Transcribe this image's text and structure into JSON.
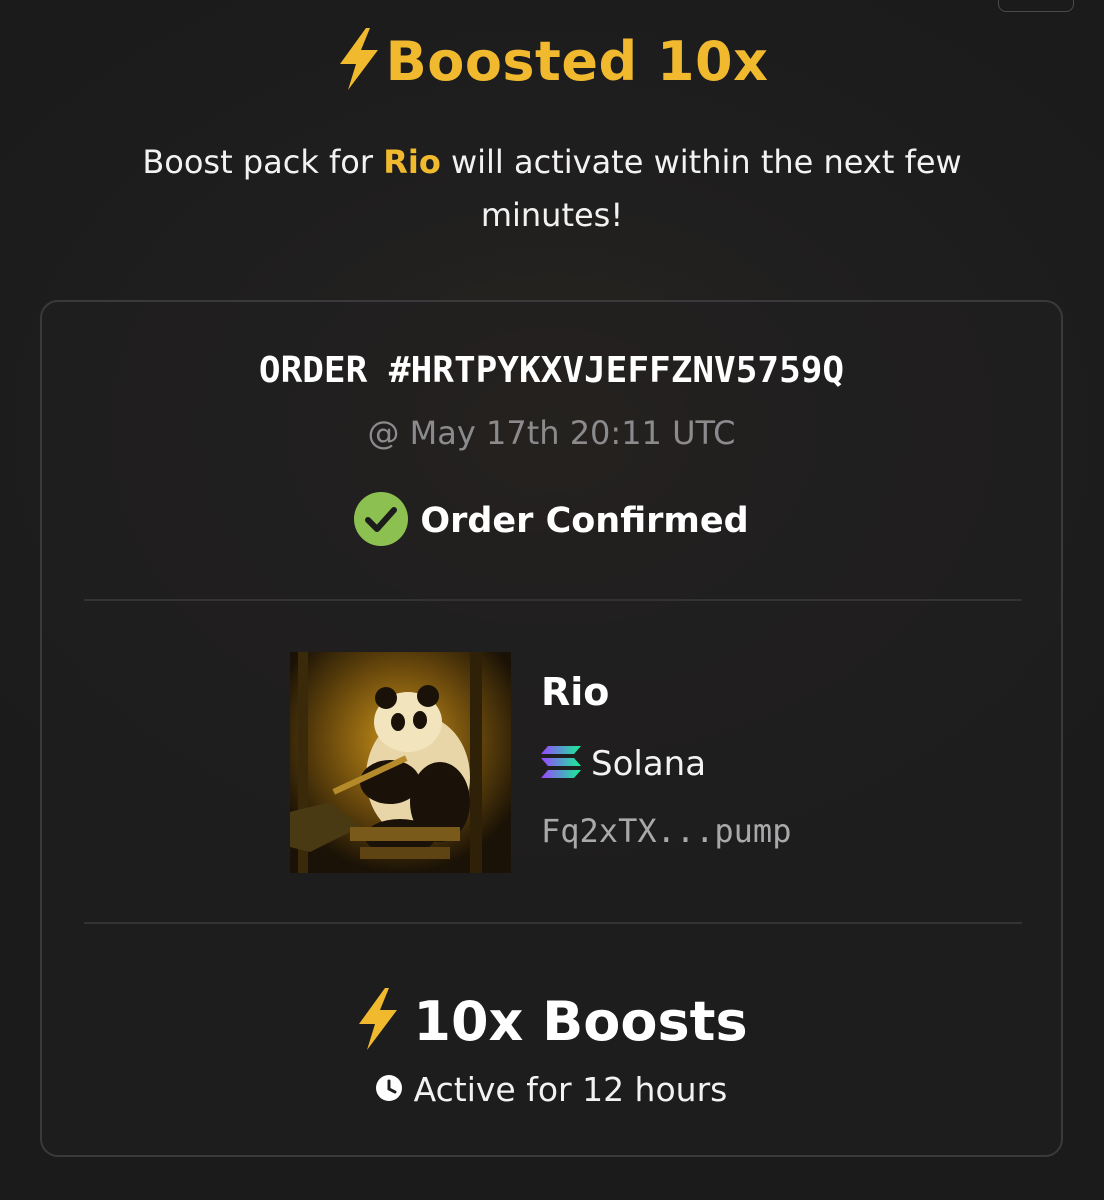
{
  "header": {
    "title": "Boosted 10x",
    "subtitle_prefix": "Boost pack for",
    "subtitle_token": "Rio",
    "subtitle_suffix": "will activate within the next few minutes!"
  },
  "order": {
    "id": "ORDER #HRTPYKXVJEFFZNV5759Q",
    "time": "@ May 17th 20:11 UTC",
    "status": "Order Confirmed"
  },
  "token": {
    "name": "Rio",
    "chain": "Solana",
    "address": "Fq2xTX...pump"
  },
  "boost": {
    "count_label": "10x Boosts",
    "duration": "Active for 12 hours"
  },
  "icons": {
    "title_icon": "lightning-bolt-icon",
    "status_icon": "check-circle-icon",
    "chain_icon": "solana-logo-icon",
    "boost_icon": "lightning-bolt-icon",
    "duration_icon": "clock-icon"
  },
  "colors": {
    "accent": "#f1b92e",
    "success": "#8cc152",
    "background": "#1e1e1f"
  }
}
